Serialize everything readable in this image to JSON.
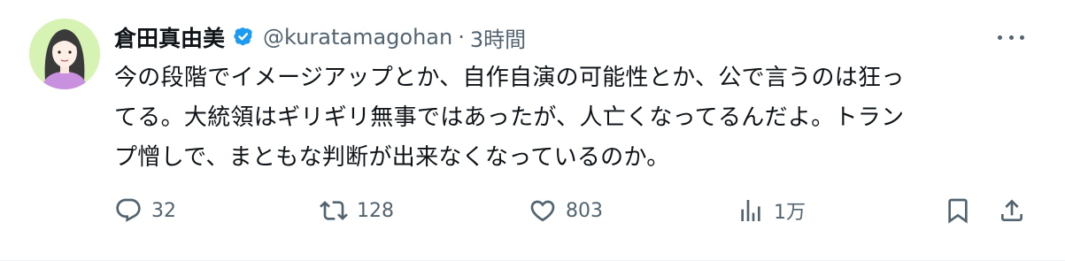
{
  "tweet": {
    "display_name": "倉田真由美",
    "handle": "@kuratamagohan",
    "separator": "·",
    "time": "3時間",
    "lines": [
      "今の段階でイメージアップとか、自作自演の可能性とか、公で言うのは狂っ",
      "てる。大統領はギリギリ無事ではあったが、人亡くなってるんだよ。トラン",
      "プ憎しで、まともな判断が出来なくなっているのか。"
    ]
  },
  "actions": {
    "reply_count": "32",
    "retweet_count": "128",
    "like_count": "803",
    "views_count": "1万"
  },
  "icons": {
    "verified": "verified-badge-icon",
    "more": "more-icon",
    "reply": "reply-icon",
    "retweet": "retweet-icon",
    "like": "heart-icon",
    "views": "views-icon",
    "bookmark": "bookmark-icon",
    "share": "share-icon"
  },
  "colors": {
    "verified": "#1d9bf0",
    "text": "#0f1419",
    "secondary": "#536471",
    "avatar_bg": "#d6f3b4"
  }
}
